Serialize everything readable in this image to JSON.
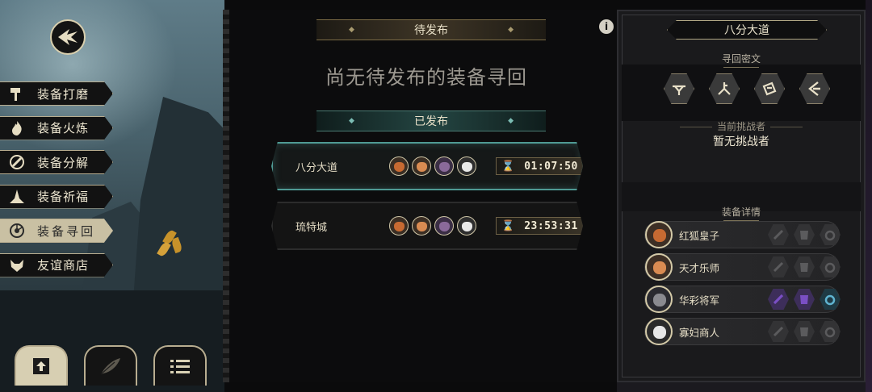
{
  "left_menu": {
    "items": [
      {
        "label": "装备打磨",
        "icon": "hammer-icon",
        "active": false
      },
      {
        "label": "装备火炼",
        "icon": "flame-icon",
        "active": false
      },
      {
        "label": "装备分解",
        "icon": "disassemble-icon",
        "active": false
      },
      {
        "label": "装备祈福",
        "icon": "pray-icon",
        "active": false
      },
      {
        "label": "装备寻回",
        "icon": "retrieve-icon",
        "active": true
      },
      {
        "label": "友谊商店",
        "icon": "fox-shop-icon",
        "active": false
      }
    ]
  },
  "bottom_tabs": [
    {
      "icon": "upload-icon",
      "active": true
    },
    {
      "icon": "feather-icon",
      "active": false
    },
    {
      "icon": "list-icon",
      "active": false
    }
  ],
  "center": {
    "pending_title": "待发布",
    "empty_message": "尚无待发布的装备寻回",
    "published_title": "已发布",
    "quests": [
      {
        "name": "八分大道",
        "timer": "01:07:50",
        "selected": true
      },
      {
        "name": "琉特城",
        "timer": "23:53:31",
        "selected": false
      }
    ]
  },
  "right_panel": {
    "title": "八分大道",
    "cipher_label": "寻回密文",
    "challenger_label": "当前挑战者",
    "challenger_value": "暂无挑战者",
    "detail_label": "装备详情",
    "heroes": [
      {
        "name": "红狐皇子",
        "slots_lit": false
      },
      {
        "name": "天才乐师",
        "slots_lit": false
      },
      {
        "name": "华彩将军",
        "slots_lit": true
      },
      {
        "name": "寡妇商人",
        "slots_lit": false
      }
    ]
  },
  "colors": {
    "accent_gold": "#b8ad90",
    "accent_teal": "#4f9a94",
    "slot_purple": "#7a4fc4"
  }
}
